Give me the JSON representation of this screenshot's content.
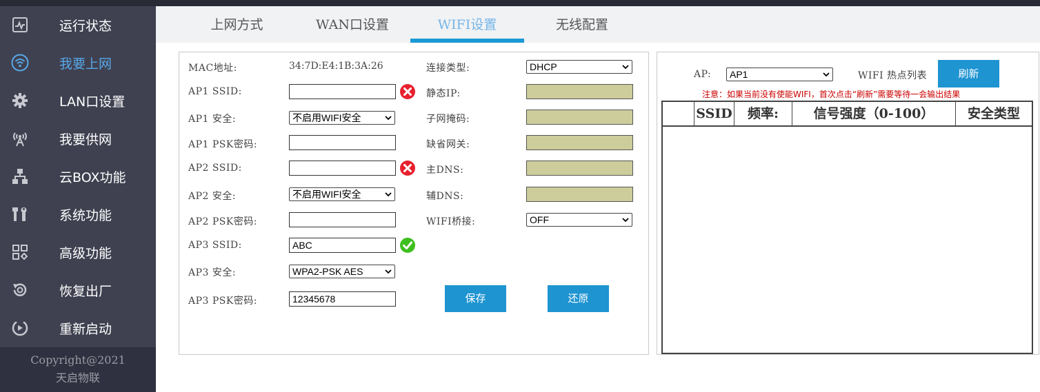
{
  "sidebar": {
    "items": [
      {
        "label": "运行状态",
        "icon": "monitor-icon"
      },
      {
        "label": "我要上网",
        "icon": "wifi-icon"
      },
      {
        "label": "LAN口设置",
        "icon": "gear-icon"
      },
      {
        "label": "我要供网",
        "icon": "antenna-icon"
      },
      {
        "label": "云BOX功能",
        "icon": "network-icon"
      },
      {
        "label": "系统功能",
        "icon": "tools-icon"
      },
      {
        "label": "高级功能",
        "icon": "apps-icon"
      },
      {
        "label": "恢复出厂",
        "icon": "restore-icon"
      },
      {
        "label": "重新启动",
        "icon": "restart-icon"
      }
    ],
    "copyright_line1": "Copyright@2021",
    "copyright_line2": "天启物联"
  },
  "tabs": [
    {
      "label": "上网方式"
    },
    {
      "label": "WAN口设置"
    },
    {
      "label": "WIFI设置"
    },
    {
      "label": "无线配置"
    }
  ],
  "form": {
    "mac_label": "MAC地址:",
    "mac_value": "34:7D:E4:1B:3A:26",
    "ap1_ssid_label": "AP1 SSID:",
    "ap1_ssid_value": "",
    "ap1_security_label": "AP1 安全:",
    "ap1_security_value": "不启用WIFI安全",
    "ap1_psk_label": "AP1 PSK密码:",
    "ap1_psk_value": "",
    "ap2_ssid_label": "AP2 SSID:",
    "ap2_ssid_value": "",
    "ap2_security_label": "AP2 安全:",
    "ap2_security_value": "不启用WIFI安全",
    "ap2_psk_label": "AP2 PSK密码:",
    "ap2_psk_value": "",
    "ap3_ssid_label": "AP3 SSID:",
    "ap3_ssid_value": "ABC",
    "ap3_security_label": "AP3 安全:",
    "ap3_security_value": "WPA2-PSK AES",
    "ap3_psk_label": "AP3 PSK密码:",
    "ap3_psk_value": "12345678",
    "conn_type_label": "连接类型:",
    "conn_type_value": "DHCP",
    "static_ip_label": "静态IP:",
    "subnet_label": "子网掩码:",
    "gateway_label": "缺省网关:",
    "dns1_label": "主DNS:",
    "dns2_label": "辅DNS:",
    "bridge_label": "WIFI桥接:",
    "bridge_value": "OFF",
    "save_label": "保存",
    "restore_label": "还原"
  },
  "scan": {
    "ap_label": "AP:",
    "ap_value": "AP1",
    "list_title": "WIFI 热点列表",
    "refresh_label": "刷新",
    "notice": "注意：如果当前没有使能WIFI，首次点击“刷新”需要等待一会输出结果",
    "columns": [
      "",
      "SSID",
      "频率:",
      "信号强度（0-100）",
      "安全类型"
    ],
    "rows": []
  },
  "colors": {
    "accent": "#1e94d1",
    "sidebar_bg": "#3f4150",
    "active_text": "#58a7e8",
    "disabled_input": "#cdcc9b",
    "notice": "#cc0000",
    "error": "#e8212e",
    "ok": "#3fbf1f"
  }
}
